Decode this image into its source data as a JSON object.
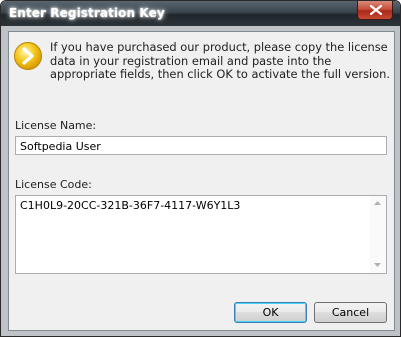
{
  "window": {
    "title": "Enter Registration Key"
  },
  "info": {
    "icon": "arrow-right-icon",
    "message": "If you have purchased our product, please copy the license data in your registration email and paste into the appropriate fields, then click OK to activate the full version."
  },
  "license_name": {
    "label": "License Name:",
    "value": "Softpedia User"
  },
  "license_code": {
    "label": "License Code:",
    "value": "C1H0L9-20CC-321B-36F7-4117-W6Y1L3"
  },
  "buttons": {
    "ok": "OK",
    "cancel": "Cancel"
  },
  "colors": {
    "icon_yellow": "#f5c518",
    "close_red": "#c6503a"
  }
}
